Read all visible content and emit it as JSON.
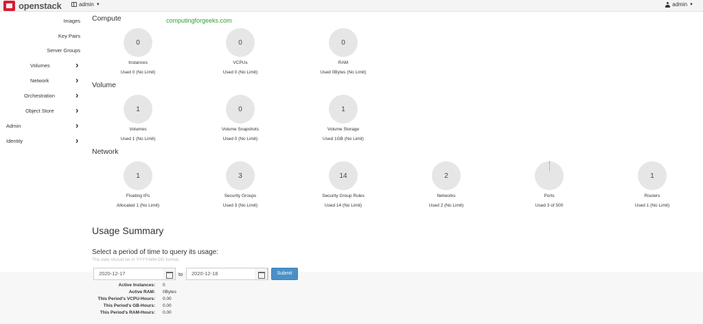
{
  "header": {
    "brand": "openstack",
    "project": "admin",
    "user": "admin"
  },
  "sidebar": {
    "items": [
      {
        "label": "Images",
        "chevron": false
      },
      {
        "label": "Key Pairs",
        "chevron": false
      },
      {
        "label": "Server Groups",
        "chevron": false
      },
      {
        "label": "Volumes",
        "chevron": true
      },
      {
        "label": "Network",
        "chevron": true
      },
      {
        "label": "Orchestration",
        "chevron": true
      },
      {
        "label": "Object Store",
        "chevron": true
      },
      {
        "label": "Admin",
        "chevron": true
      },
      {
        "label": "Identity",
        "chevron": true
      }
    ]
  },
  "watermark": "computingforgeeks.com",
  "sections": {
    "compute": {
      "title": "Compute",
      "widgets": [
        {
          "value": "0",
          "label": "Instances",
          "used": "Used 0 (No Limit)"
        },
        {
          "value": "0",
          "label": "VCPUs",
          "used": "Used 0 (No Limit)"
        },
        {
          "value": "0",
          "label": "RAM",
          "used": "Used 0Bytes (No Limit)"
        }
      ]
    },
    "volume": {
      "title": "Volume",
      "widgets": [
        {
          "value": "1",
          "label": "Volumes",
          "used": "Used 1 (No Limit)"
        },
        {
          "value": "0",
          "label": "Volume Snapshots",
          "used": "Used 0 (No Limit)"
        },
        {
          "value": "1",
          "label": "Volume Storage",
          "used": "Used 1GB (No Limit)"
        }
      ]
    },
    "network": {
      "title": "Network",
      "widgets": [
        {
          "value": "1",
          "label": "Floating IPs",
          "used": "Allocated 1 (No Limit)"
        },
        {
          "value": "3",
          "label": "Security Groups",
          "used": "Used 3 (No Limit)"
        },
        {
          "value": "14",
          "label": "Security Group Rules",
          "used": "Used 14 (No Limit)"
        },
        {
          "value": "2",
          "label": "Networks",
          "used": "Used 2 (No Limit)"
        },
        {
          "value": "",
          "label": "Ports",
          "used": "Used 3 of 500",
          "fraction": 0.006
        },
        {
          "value": "1",
          "label": "Routers",
          "used": "Used 1 (No Limit)"
        }
      ]
    }
  },
  "usage": {
    "title": "Usage Summary",
    "period_title": "Select a period of time to query its usage:",
    "period_hint": "The date should be in YYYY-MM-DD format.",
    "start_date": "2020-12-17",
    "to_label": "to",
    "end_date": "2020-12-18",
    "submit_label": "Submit",
    "summary": [
      {
        "key": "Active Instances:",
        "value": "0"
      },
      {
        "key": "Active RAM:",
        "value": "0Bytes"
      },
      {
        "key": "This Period's VCPU-Hours:",
        "value": "0.00"
      },
      {
        "key": "This Period's GB-Hours:",
        "value": "0.00"
      },
      {
        "key": "This Period's RAM-Hours:",
        "value": "0.00"
      }
    ]
  },
  "colors": {
    "brand_red": "#da1a32",
    "watermark_green": "#2fa12f",
    "pie_gray": "#e6e6e6",
    "pie_fill": "#5b8fd6",
    "submit_blue": "#4a90c8"
  }
}
